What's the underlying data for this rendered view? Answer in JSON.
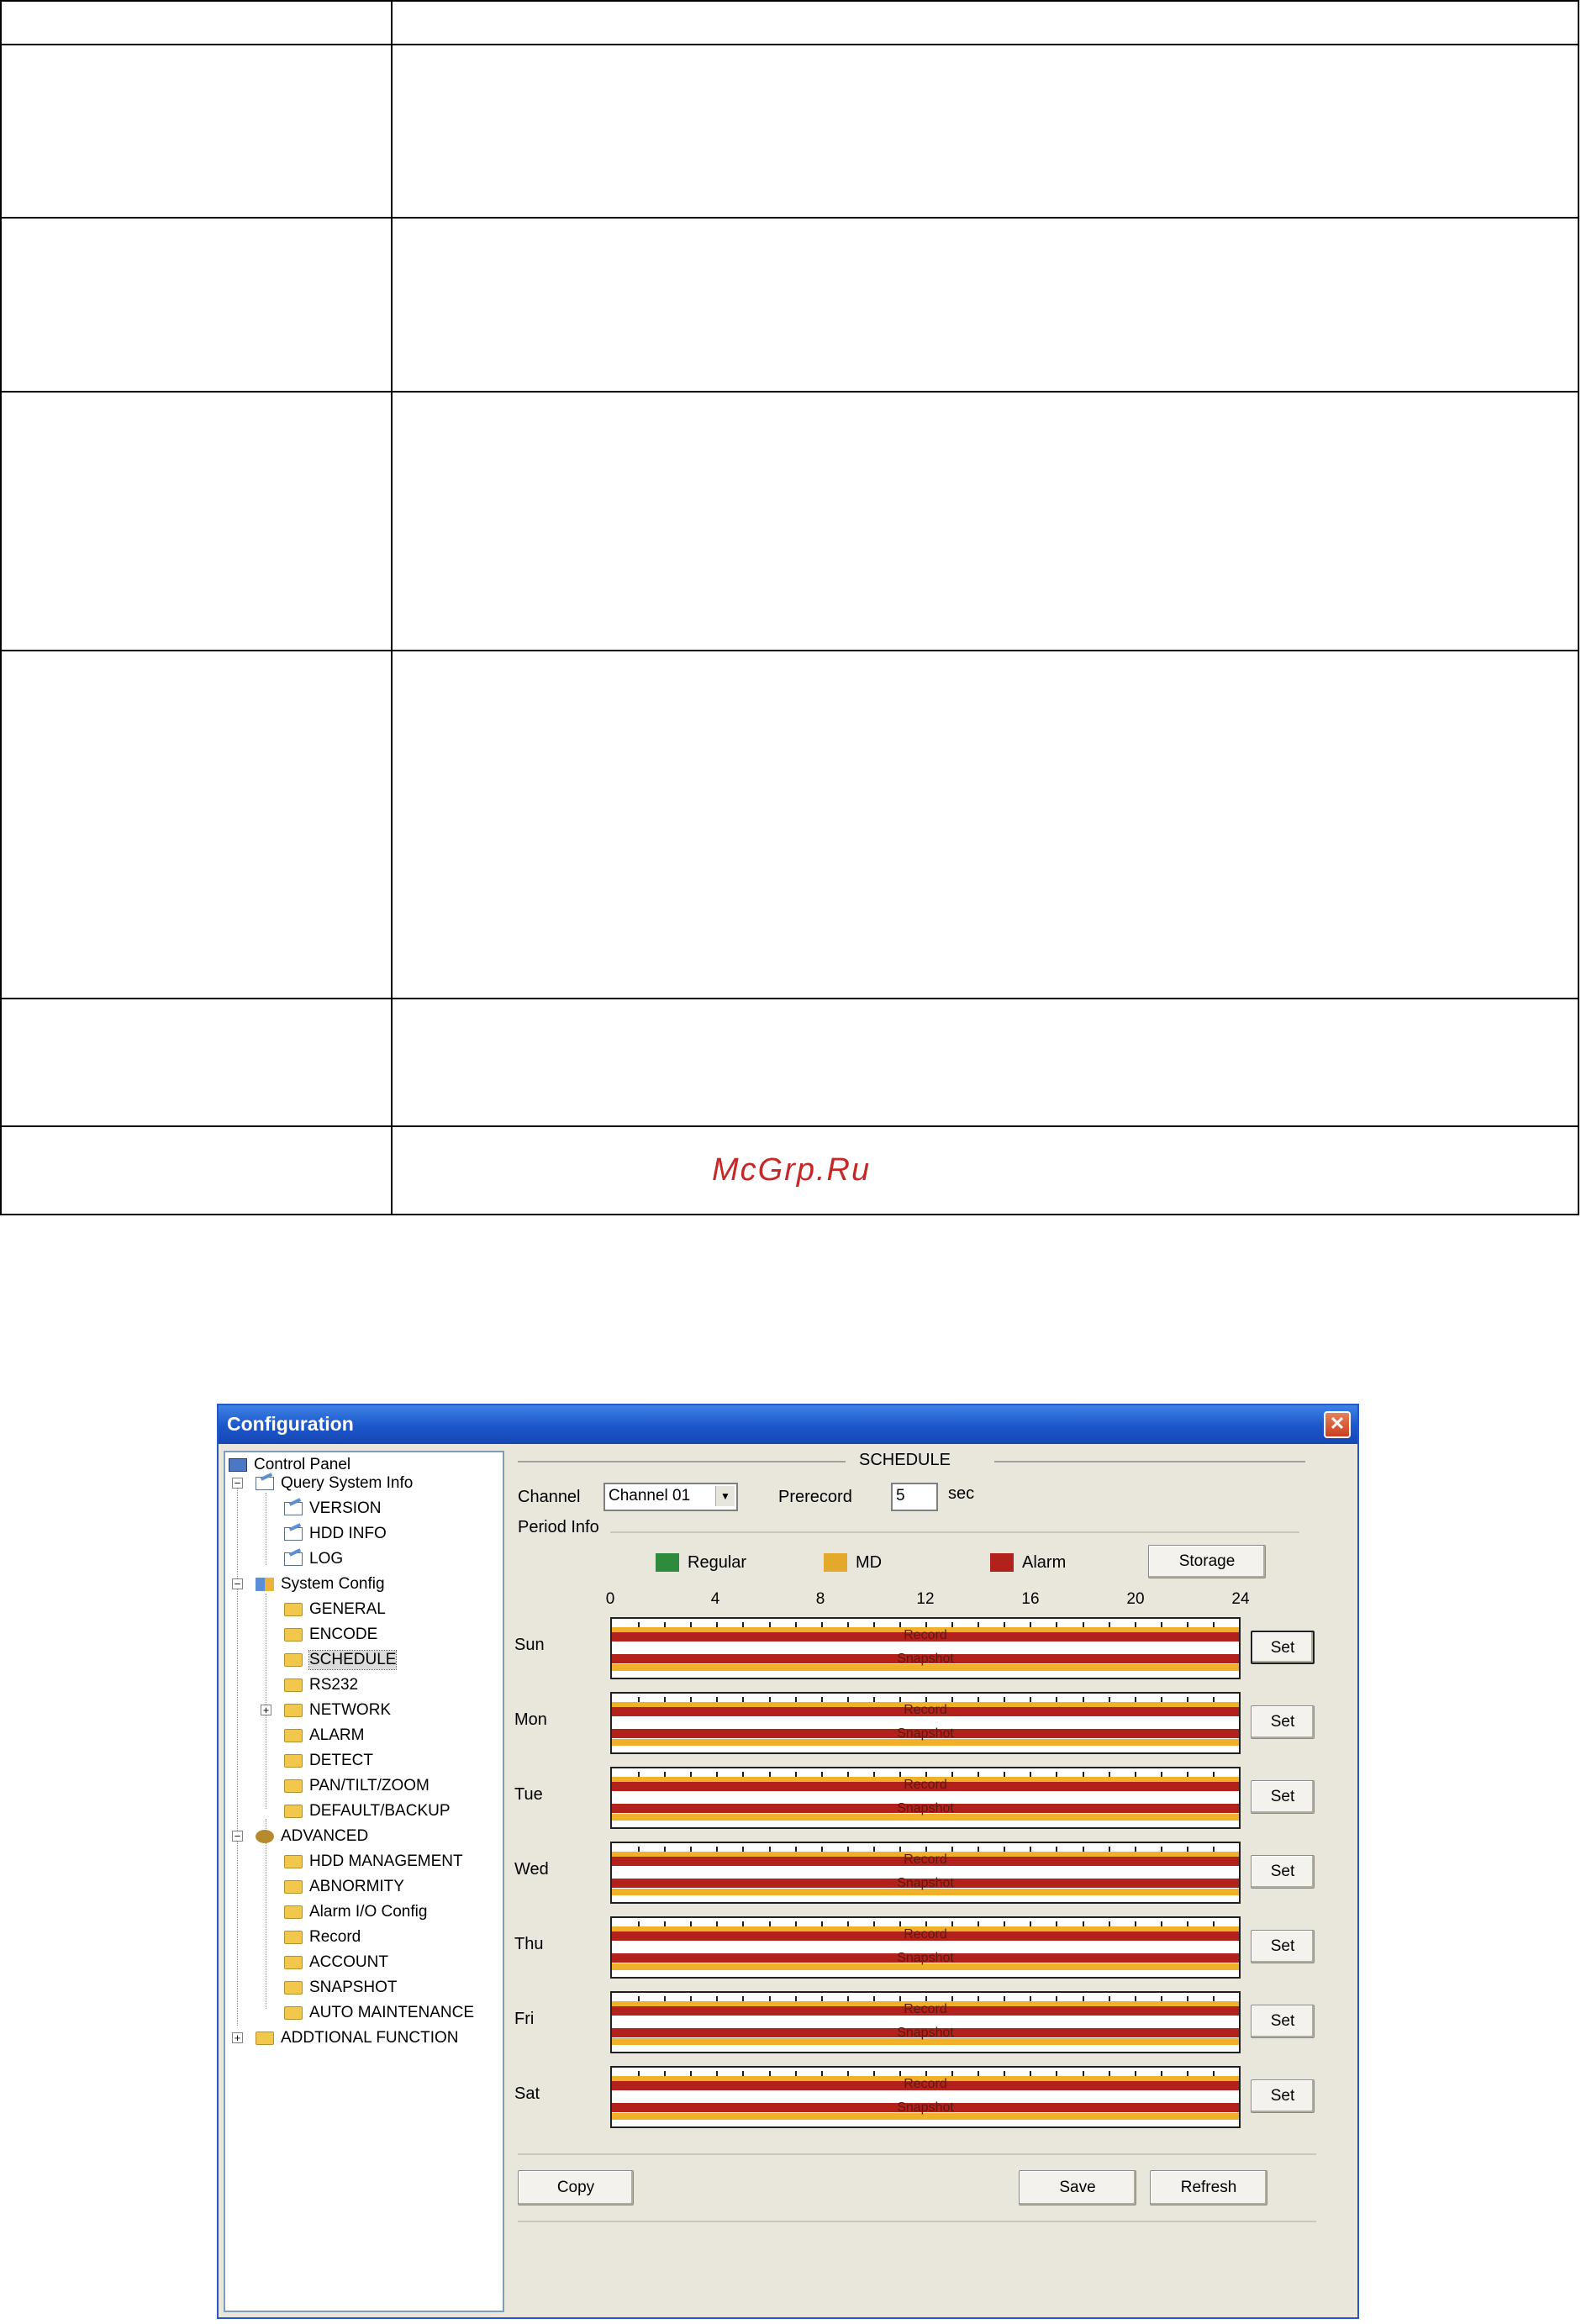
{
  "document": {
    "watermark": "McGrp.Ru"
  },
  "window": {
    "title": "Configuration",
    "close_glyph": "✕"
  },
  "tree": {
    "root": "Control Panel",
    "query": "Query System Info",
    "version": "VERSION",
    "hdd_info": "HDD INFO",
    "log": "LOG",
    "system": "System Config",
    "general": "GENERAL",
    "encode": "ENCODE",
    "schedule": "SCHEDULE",
    "rs232": "RS232",
    "network": "NETWORK",
    "alarm": "ALARM",
    "detect": "DETECT",
    "ptz": "PAN/TILT/ZOOM",
    "default_backup": "DEFAULT/BACKUP",
    "advanced": "ADVANCED",
    "hdd_mgmt": "HDD MANAGEMENT",
    "abnormity": "ABNORMITY",
    "alarm_io": "Alarm I/O Config",
    "record": "Record",
    "account": "ACCOUNT",
    "snapshot": "SNAPSHOT",
    "auto_maint": "AUTO MAINTENANCE",
    "additional": "ADDTIONAL FUNCTION"
  },
  "schedule": {
    "title": "SCHEDULE",
    "channel_label": "Channel",
    "channel_value": "Channel 01",
    "prerecord_label": "Prerecord",
    "prerecord_value": "5",
    "sec_label": "sec",
    "period_info_label": "Period Info",
    "legend": {
      "regular": "Regular",
      "md": "MD",
      "alarm": "Alarm"
    },
    "storage_button": "Storage",
    "hours": [
      "0",
      "4",
      "8",
      "12",
      "16",
      "20",
      "24"
    ],
    "days": [
      "Sun",
      "Mon",
      "Tue",
      "Wed",
      "Thu",
      "Fri",
      "Sat"
    ],
    "record_label": "Record",
    "snapshot_label": "Snapshot",
    "set_button": "Set",
    "copy_button": "Copy",
    "save_button": "Save",
    "refresh_button": "Refresh"
  },
  "colors": {
    "regular": "#2e8b3e",
    "md": "#e4a82b",
    "alarm": "#b3211c",
    "titlebar": "#1b56c9"
  }
}
